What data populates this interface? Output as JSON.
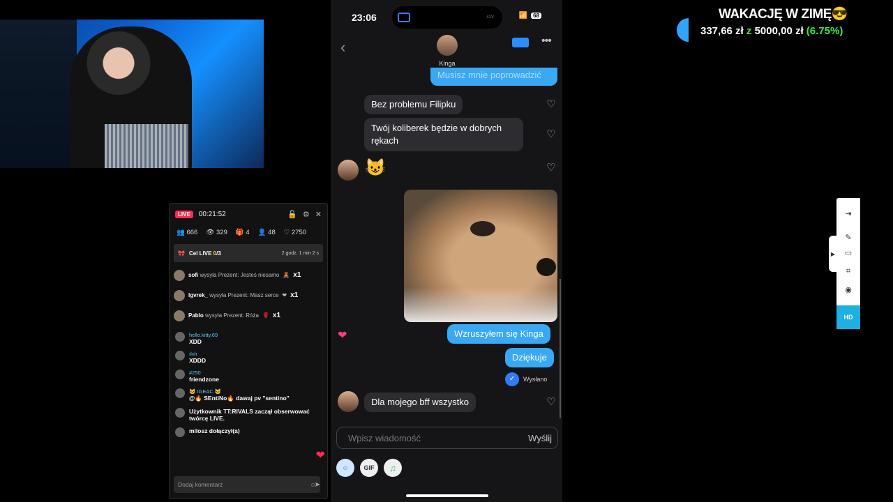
{
  "stream": {
    "live_badge": "LIVE",
    "elapsed": "00:21:52",
    "stats": {
      "users": "666",
      "viewers": "329",
      "gifts": "4",
      "new_followers": "48",
      "likes": "2750"
    },
    "goal": {
      "label": "Cel LIVE",
      "progress": "0",
      "total": "/3",
      "remaining": "2 godz. 1 min 2 s"
    },
    "gifts": [
      {
        "user": "sofi",
        "text": "wysyła Prezent: Jesteś niesamo",
        "count": "x1"
      },
      {
        "user": "lgvrek_",
        "text": "wysyła Prezent: Masz serce",
        "count": "x1"
      },
      {
        "user": "Pablo",
        "text": "wysyła Prezent: Róża",
        "count": "x1"
      }
    ],
    "chat": [
      {
        "user": "hello.kitty.69",
        "text": "XDD"
      },
      {
        "user": "ılıılı",
        "text": "XDDD"
      },
      {
        "user": "#250",
        "text": "friendzone"
      },
      {
        "user": "🐱 IGEAC 🐱",
        "text": "@🔥 SEntiNo🔥 dawaj pv \"sentino\""
      },
      {
        "user": "",
        "text": "Użytkownik TT:RIVALS zaczął obserwować twórcę LIVE."
      },
      {
        "user": "",
        "text": "milosz dołączył(a)"
      }
    ],
    "comment_placeholder": "Dodaj komentarz"
  },
  "phone": {
    "time": "23:06",
    "battery": "68",
    "lens_label": "41V",
    "contact_name": "Kinga",
    "messages": {
      "top_cut": "Musisz mnie poprowadzić",
      "m1": "Bez problemu Filipku",
      "m2_line1": "Twój koliberek będzie w dobrych",
      "m2_line2": "rękach",
      "emoji": "😺",
      "m3": "Wzruszyłem się Kinga",
      "m4": "Dziękuje",
      "sent_status": "Wysłano",
      "m5": "Dla mojego bff wszystko"
    },
    "input_placeholder": "Wpisz wiadomość",
    "send_label": "Wyślij",
    "tools": {
      "gif": "GIF",
      "music": "♫",
      "sticker": "☺"
    }
  },
  "goal_widget": {
    "title": "WAKACJĘ W ZIMĘ😎",
    "current": "337,66 zł",
    "separator": "z",
    "target": "5000,00 zł",
    "percent": "(6.75%)",
    "progress_fraction": 0.0675
  },
  "sidebar": {
    "hd_label": "HD"
  }
}
